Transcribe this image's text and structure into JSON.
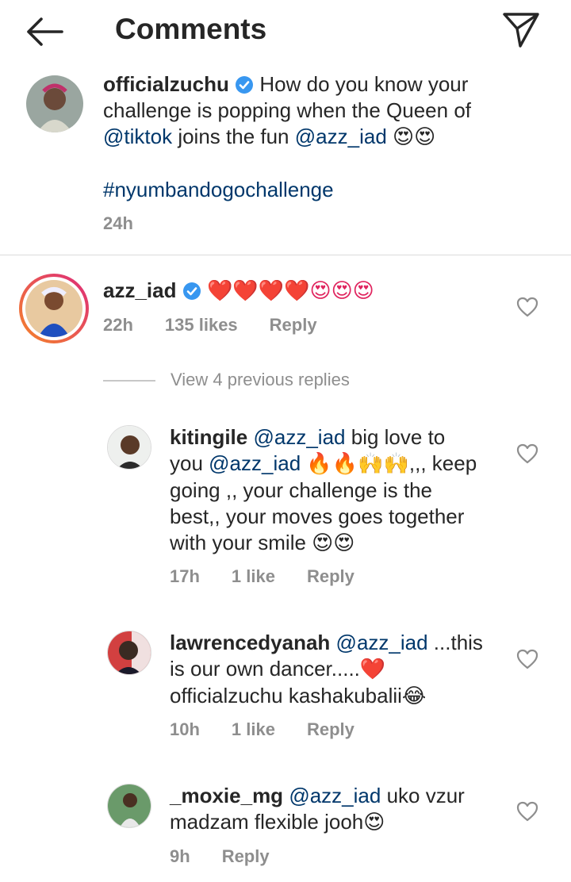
{
  "header": {
    "title": "Comments"
  },
  "post": {
    "username": "officialzuchu",
    "text_1": "How do you know your",
    "text_2": "challenge is popping when the Queen of",
    "mention_1": "@tiktok",
    "text_3": "joins the fun",
    "mention_2": "@azz_iad",
    "emojis": "😍😍",
    "hashtag": "#nyumbandogochallenge",
    "time": "24h"
  },
  "top_comment": {
    "username": "azz_iad",
    "emojis": "❤️❤️❤️❤️😍😍😍",
    "time": "22h",
    "likes": "135 likes",
    "reply": "Reply"
  },
  "view_replies": "View 4 previous replies",
  "replies": [
    {
      "username": "kitingile",
      "mention_1": "@azz_iad",
      "text_1": "big love to",
      "text_2": "you",
      "mention_2": "@azz_iad",
      "emojis_1": "🔥🔥🙌🙌",
      "text_3": ",,, keep",
      "text_4": "going ,, your challenge is the",
      "text_5": "best,, your moves goes together",
      "text_6": "with your smile",
      "emojis_2": "😍😍",
      "time": "17h",
      "likes": "1 like",
      "reply": "Reply"
    },
    {
      "username": "lawrencedyanah",
      "mention_1": "@azz_iad",
      "text_1": "...this",
      "text_2": "is our own dancer.....",
      "emojis_1": "❤️",
      "text_3": "officialzuchu kashakubalii",
      "emojis_2": "😂",
      "time": "10h",
      "likes": "1 like",
      "reply": "Reply"
    },
    {
      "username": "_moxie_mg",
      "mention_1": "@azz_iad",
      "text_1": "uko vzur",
      "text_2": "madzam flexible jooh",
      "emojis_1": "😍",
      "time": "9h",
      "reply": "Reply"
    }
  ],
  "icons": {
    "back": "arrow-left-icon",
    "share": "paper-plane-icon",
    "like": "heart-outline-icon",
    "verified": "verified-badge-icon"
  },
  "colors": {
    "link": "#00376b",
    "verified": "#3897f0",
    "muted": "#8e8e8e",
    "story_ring_start": "#f58529",
    "story_ring_end": "#dd2a7b"
  }
}
